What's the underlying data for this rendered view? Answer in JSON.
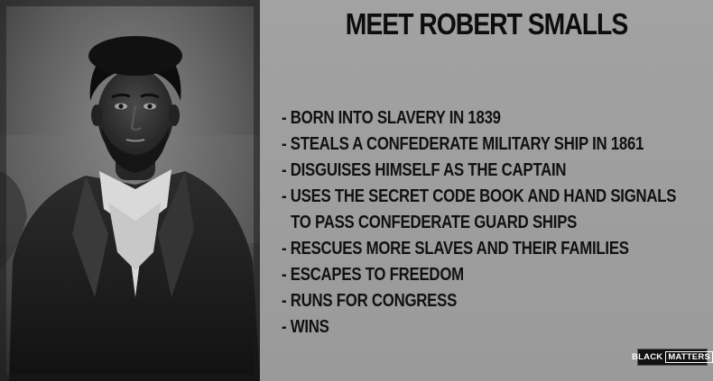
{
  "title": "MEET ROBERT SMALLS",
  "facts": [
    "- BORN INTO SLAVERY IN 1839",
    "- STEALS A CONFEDERATE MILITARY SHIP IN 1861",
    "- DISGUISES HIMSELF AS THE CAPTAIN",
    "- USES THE SECRET CODE BOOK AND HAND SIGNALS",
    "TO PASS CONFEDERATE GUARD SHIPS",
    "- RESCUES MORE SLAVES AND THEIR FAMILIES",
    "- ESCAPES TO FREEDOM",
    "- RUNS FOR CONGRESS",
    "- WINS"
  ],
  "logo": {
    "part1": "BLACK",
    "part2": "MATTERS"
  },
  "colors": {
    "panel_background": "#9c9c9c",
    "text": "#111111"
  }
}
